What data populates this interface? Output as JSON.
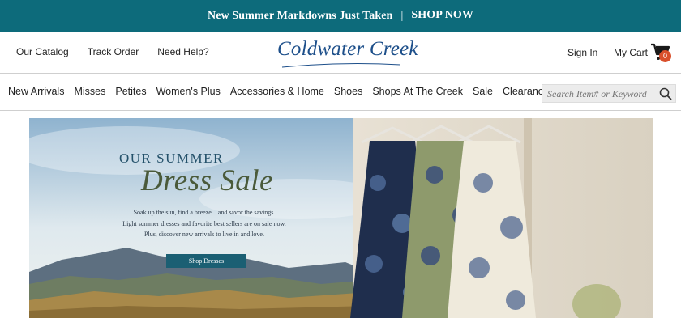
{
  "promo": {
    "message": "New Summer Markdowns Just Taken",
    "separator": "|",
    "link": "SHOP NOW"
  },
  "utility": {
    "links": [
      "Our Catalog",
      "Track Order",
      "Need Help?"
    ],
    "logo": "Coldwater Creek",
    "sign_in": "Sign In",
    "cart_label": "My Cart",
    "cart_count": "0"
  },
  "nav": {
    "items": [
      "New Arrivals",
      "Misses",
      "Petites",
      "Women's Plus",
      "Accessories & Home",
      "Shoes",
      "Shops At The Creek",
      "Sale",
      "Clearance"
    ]
  },
  "search": {
    "placeholder": "Search Item# or Keyword"
  },
  "hero": {
    "eyebrow": "OUR SUMMER",
    "title": "Dress Sale",
    "copy_lines": [
      "Soak up the sun, find a breeze... and savor the savings.",
      "Light summer dresses and favorite best sellers are on sale now.",
      "Plus, discover new arrivals to live in and love."
    ],
    "cta": "Shop Dresses"
  },
  "colors": {
    "promo_bg": "#0d6b7b",
    "logo": "#1d4f8a",
    "cart_badge": "#d94f2b",
    "cta_bg": "#1b5f73"
  }
}
